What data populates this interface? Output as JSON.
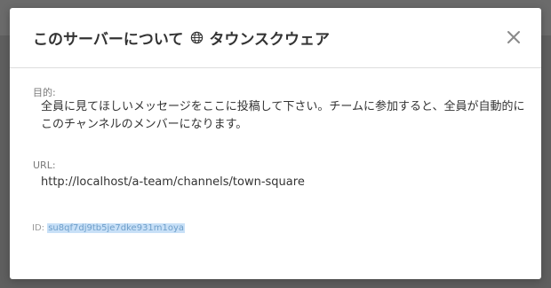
{
  "modal": {
    "title_prefix": "このサーバーについて",
    "channel_name": "タウンスクウェア",
    "purpose_label": "目的:",
    "purpose_text": "全員に見てほしいメッセージをここに投稿して下さい。チームに参加すると、全員が自動的にこのチャンネルのメンバーになります。",
    "url_label": "URL:",
    "url_value": "http://localhost/a-team/channels/town-square",
    "id_label": "ID:",
    "id_value": "su8qf7dj9tb5je7dke931m1oya"
  },
  "colors": {
    "backdrop": "#5f5f5f",
    "title_text": "#333333",
    "label_text": "#7a7a7a",
    "id_highlight": "#c8e0f7"
  },
  "icons": {
    "channel": "globe-icon",
    "close": "close-icon"
  }
}
